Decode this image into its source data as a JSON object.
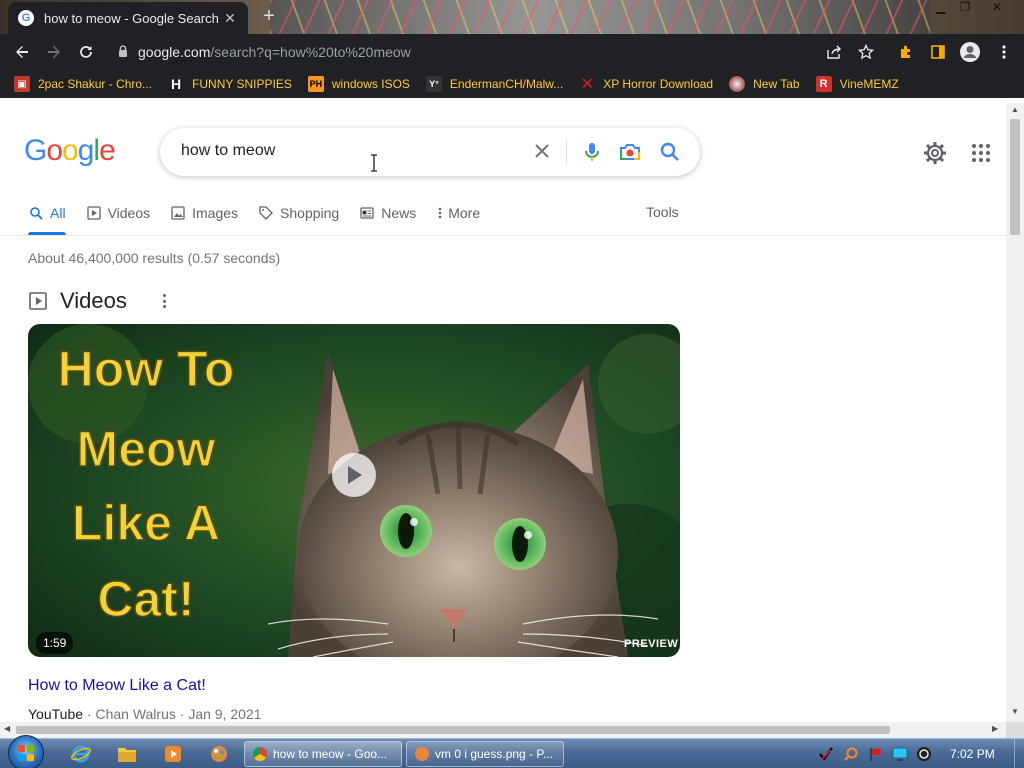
{
  "browser": {
    "tab_title": "how to meow - Google Search",
    "tab_close": "✕",
    "new_tab": "+",
    "url_host": "google.com",
    "url_path": "/search?q=how%20to%20meow"
  },
  "bookmarks": [
    {
      "label": "2pac Shakur - Chro...",
      "icon": "2pac-icon",
      "color": "#c0392b"
    },
    {
      "label": "FUNNY SNIPPIES",
      "icon": "h-icon",
      "color": "#ffffff"
    },
    {
      "label": "windows ISOS",
      "icon": "ph-icon",
      "color": "#f7971d"
    },
    {
      "label": "EndermanCH/Malw...",
      "icon": "yp-icon",
      "color": "#444444"
    },
    {
      "label": "XP Horror Download",
      "icon": "x-icon",
      "color": "#e01b1b"
    },
    {
      "label": "New Tab",
      "icon": "ball-icon",
      "color": "#b55"
    },
    {
      "label": "VineMEMZ",
      "icon": "r-icon",
      "color": "#d32f2f"
    }
  ],
  "google": {
    "logo": [
      "G",
      "o",
      "o",
      "g",
      "l",
      "e"
    ],
    "query": "how to meow",
    "tabs": [
      {
        "label": "All",
        "icon": "search-icon",
        "active": true
      },
      {
        "label": "Videos",
        "icon": "video-icon",
        "active": false
      },
      {
        "label": "Images",
        "icon": "image-icon",
        "active": false
      },
      {
        "label": "Shopping",
        "icon": "tag-icon",
        "active": false
      },
      {
        "label": "News",
        "icon": "news-icon",
        "active": false
      },
      {
        "label": "More",
        "icon": "more-vert-icon",
        "active": false
      }
    ],
    "tools_label": "Tools",
    "stats": "About 46,400,000 results (0.57 seconds)",
    "videos_heading": "Videos",
    "video": {
      "thumb_lines": [
        "How To",
        "Meow",
        "Like A",
        "Cat!"
      ],
      "duration": "1:59",
      "preview_label": "PREVIEW",
      "title": "How to Meow Like a Cat!",
      "source": "YouTube",
      "channel": "Chan Walrus",
      "date": "Jan 9, 2021",
      "separator": " · "
    }
  },
  "taskbar": {
    "buttons": [
      {
        "label": "how to meow - Goo..."
      },
      {
        "label": "vm 0 i guess.png - P..."
      }
    ],
    "clock": "7:02 PM"
  },
  "colors": {
    "google_blue": "#4285f4",
    "google_red": "#ea4335",
    "google_yellow": "#fbbc05",
    "google_green": "#34a853",
    "link": "#1a0dab",
    "active_tab": "#1a73e8"
  }
}
